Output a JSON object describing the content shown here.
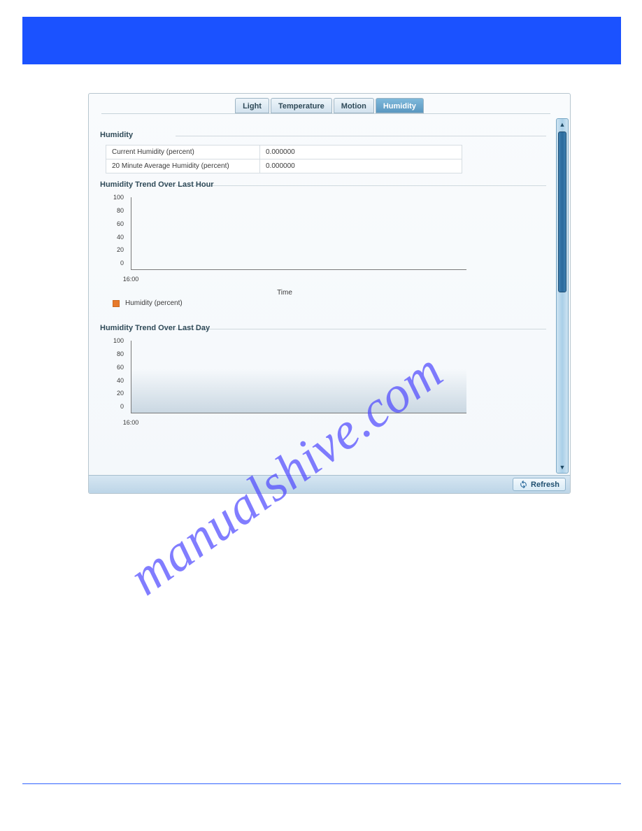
{
  "watermark": "manualshive.com",
  "tabs": {
    "light": "Light",
    "temperature": "Temperature",
    "motion": "Motion",
    "humidity": "Humidity",
    "active": "humidity"
  },
  "sections": {
    "humidity_title": "Humidity",
    "trend_hour_title": "Humidity Trend Over Last Hour",
    "trend_day_title": "Humidity Trend Over Last Day"
  },
  "readings": {
    "current_label": "Current Humidity (percent)",
    "current_value": "0.000000",
    "avg20_label": "20 Minute Average Humidity (percent)",
    "avg20_value": "0.000000"
  },
  "legend": {
    "series": "Humidity (percent)",
    "color": "#e77a2b"
  },
  "buttons": {
    "refresh": "Refresh"
  },
  "chart_data": [
    {
      "type": "line",
      "id": "humidity_last_hour",
      "title": "Humidity Trend Over Last Hour",
      "xlabel": "Time",
      "ylabel": "",
      "ylim": [
        0,
        100
      ],
      "y_ticks": [
        0,
        20,
        40,
        60,
        80,
        100
      ],
      "x_ticks": [
        "16:00"
      ],
      "series": [
        {
          "name": "Humidity (percent)",
          "color": "#e77a2b",
          "x": [],
          "y": []
        }
      ]
    },
    {
      "type": "line",
      "id": "humidity_last_day",
      "title": "Humidity Trend Over Last Day",
      "xlabel": "",
      "ylabel": "",
      "ylim": [
        0,
        100
      ],
      "y_ticks": [
        0,
        20,
        40,
        60,
        80,
        100
      ],
      "x_ticks": [
        "16:00"
      ],
      "series": [
        {
          "name": "Humidity (percent)",
          "color": "#e77a2b",
          "x": [],
          "y": []
        }
      ]
    }
  ]
}
